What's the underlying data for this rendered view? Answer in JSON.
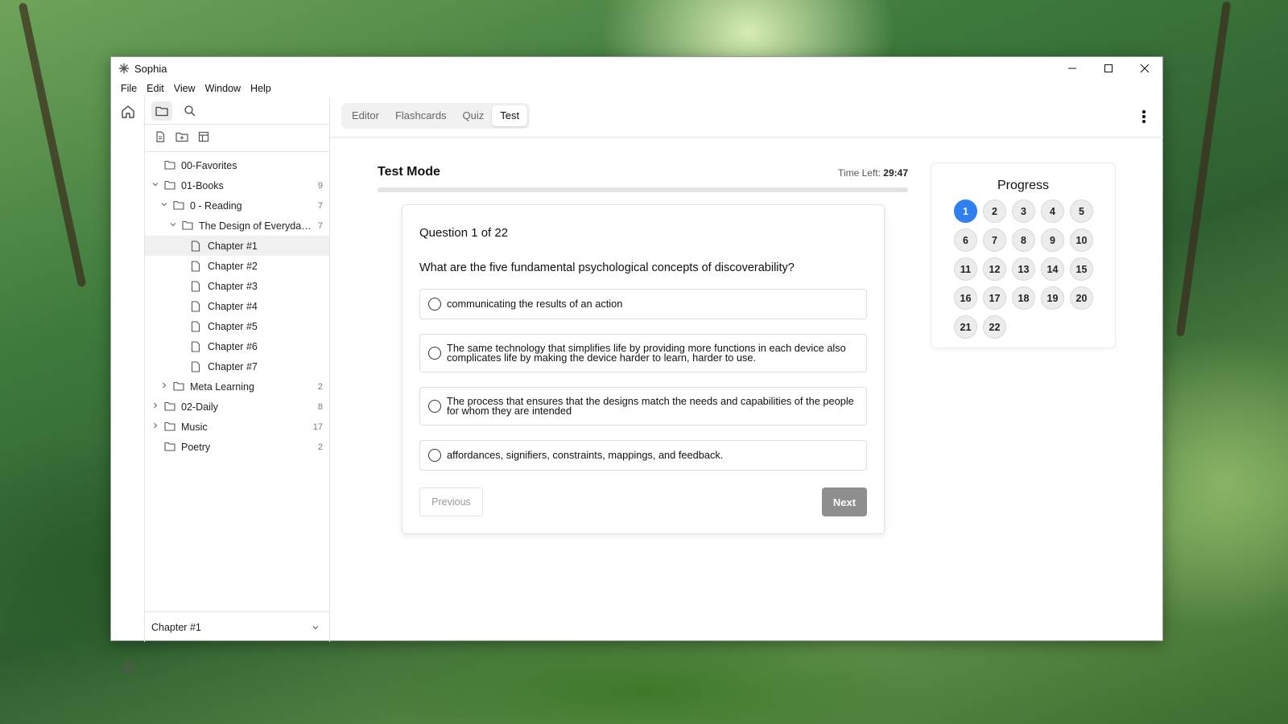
{
  "window": {
    "title": "Sophia"
  },
  "menu": [
    "File",
    "Edit",
    "View",
    "Window",
    "Help"
  ],
  "tree": [
    {
      "label": "00-Favorites",
      "count": "",
      "type": "folder",
      "depth": 0,
      "chevron": ""
    },
    {
      "label": "01-Books",
      "count": "9",
      "type": "folder",
      "depth": 0,
      "chevron": "open"
    },
    {
      "label": "0 - Reading",
      "count": "7",
      "type": "folder",
      "depth": 1,
      "chevron": "open"
    },
    {
      "label": "The Design of Everyday ...",
      "count": "7",
      "type": "folder",
      "depth": 2,
      "chevron": "open"
    },
    {
      "label": "Chapter #1",
      "count": "",
      "type": "file",
      "depth": 3,
      "chevron": "",
      "selected": true
    },
    {
      "label": "Chapter #2",
      "count": "",
      "type": "file",
      "depth": 3,
      "chevron": ""
    },
    {
      "label": "Chapter #3",
      "count": "",
      "type": "file",
      "depth": 3,
      "chevron": ""
    },
    {
      "label": "Chapter #4",
      "count": "",
      "type": "file",
      "depth": 3,
      "chevron": ""
    },
    {
      "label": "Chapter #5",
      "count": "",
      "type": "file",
      "depth": 3,
      "chevron": ""
    },
    {
      "label": "Chapter #6",
      "count": "",
      "type": "file",
      "depth": 3,
      "chevron": ""
    },
    {
      "label": "Chapter #7",
      "count": "",
      "type": "file",
      "depth": 3,
      "chevron": ""
    },
    {
      "label": "Meta Learning",
      "count": "2",
      "type": "folder",
      "depth": 1,
      "chevron": "closed"
    },
    {
      "label": "02-Daily",
      "count": "8",
      "type": "folder",
      "depth": 0,
      "chevron": "closed"
    },
    {
      "label": "Music",
      "count": "17",
      "type": "folder",
      "depth": 0,
      "chevron": "closed"
    },
    {
      "label": "Poetry",
      "count": "2",
      "type": "folder",
      "depth": 0,
      "chevron": ""
    }
  ],
  "sidebar": {
    "current_note": "Chapter #1"
  },
  "tabs": [
    {
      "label": "Editor",
      "active": false
    },
    {
      "label": "Flashcards",
      "active": false
    },
    {
      "label": "Quiz",
      "active": false
    },
    {
      "label": "Test",
      "active": true
    }
  ],
  "test": {
    "title": "Test Mode",
    "time_left_label": "Time Left:",
    "time_left_value": "29:47",
    "question_label": "Question 1 of 22",
    "question_text": "What are the five fundamental psychological concepts of discoverability?",
    "options": [
      "communicating the results of an action",
      "The same technology that simplifies life by providing more functions in each device also complicates life by making the device harder to learn, harder to use.",
      "The process that ensures that the designs match the needs and capabilities of the people for whom they are intended",
      "affordances, signifiers, constraints, mappings, and feedback."
    ],
    "previous_label": "Previous",
    "next_label": "Next"
  },
  "progress": {
    "title": "Progress",
    "current": 1,
    "items": [
      "1",
      "2",
      "3",
      "4",
      "5",
      "6",
      "7",
      "8",
      "9",
      "10",
      "11",
      "12",
      "13",
      "14",
      "15",
      "16",
      "17",
      "18",
      "19",
      "20",
      "21",
      "22"
    ]
  },
  "colors": {
    "accent": "#2f7ff0",
    "next_button": "#8e8e8e"
  }
}
